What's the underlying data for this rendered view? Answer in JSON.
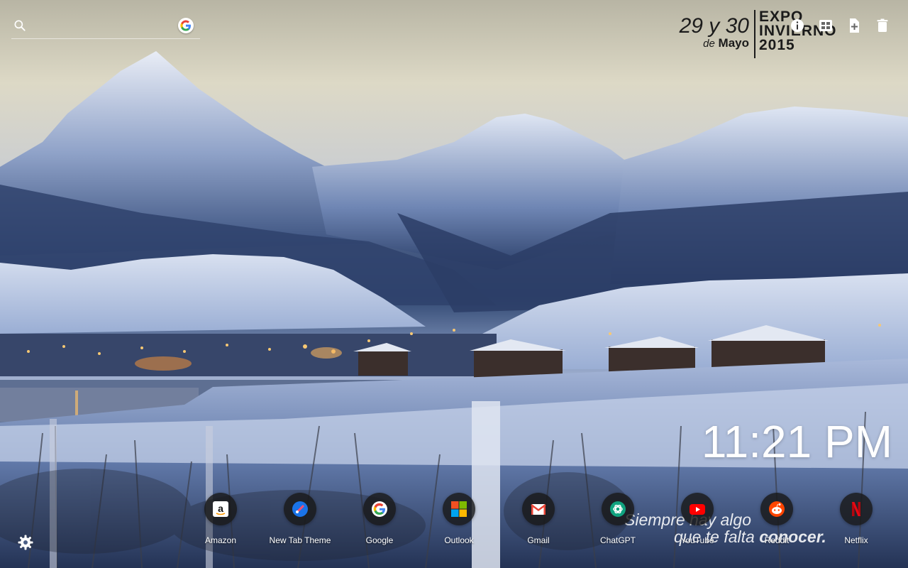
{
  "search": {
    "placeholder": "",
    "engine": "google-icon"
  },
  "wallpaper": {
    "expo_date": "29 y 30",
    "expo_de": "de",
    "expo_month": "Mayo",
    "expo_line1": "EXPO",
    "expo_line2": "INVIERNO",
    "expo_line3": "2015",
    "slogan_line1": "Siempre hay algo",
    "slogan_line2a": "que te falta",
    "slogan_line2b": "conocer."
  },
  "toolbar": {
    "icons": [
      "info-icon",
      "image-settings-icon",
      "add-file-icon",
      "trash-icon"
    ]
  },
  "clock": {
    "time": "11:21 PM"
  },
  "shortcuts": [
    {
      "label": "Amazon",
      "icon": "amazon-icon"
    },
    {
      "label": "New Tab Theme",
      "icon": "new-tab-theme-icon"
    },
    {
      "label": "Google",
      "icon": "google-icon"
    },
    {
      "label": "Outlook",
      "icon": "microsoft-icon"
    },
    {
      "label": "Gmail",
      "icon": "gmail-icon"
    },
    {
      "label": "ChatGPT",
      "icon": "chatgpt-icon"
    },
    {
      "label": "YouTube",
      "icon": "youtube-icon"
    },
    {
      "label": "Reddit",
      "icon": "reddit-icon"
    },
    {
      "label": "Netflix",
      "icon": "netflix-icon"
    }
  ],
  "colors": {
    "tile_bg": "#191919",
    "text": "#ffffff",
    "gmail_red": "#ea4335",
    "youtube_red": "#ff0000",
    "reddit_orange": "#ff4500",
    "netflix_red": "#e50914",
    "outlook_blue": "#0078d4"
  }
}
